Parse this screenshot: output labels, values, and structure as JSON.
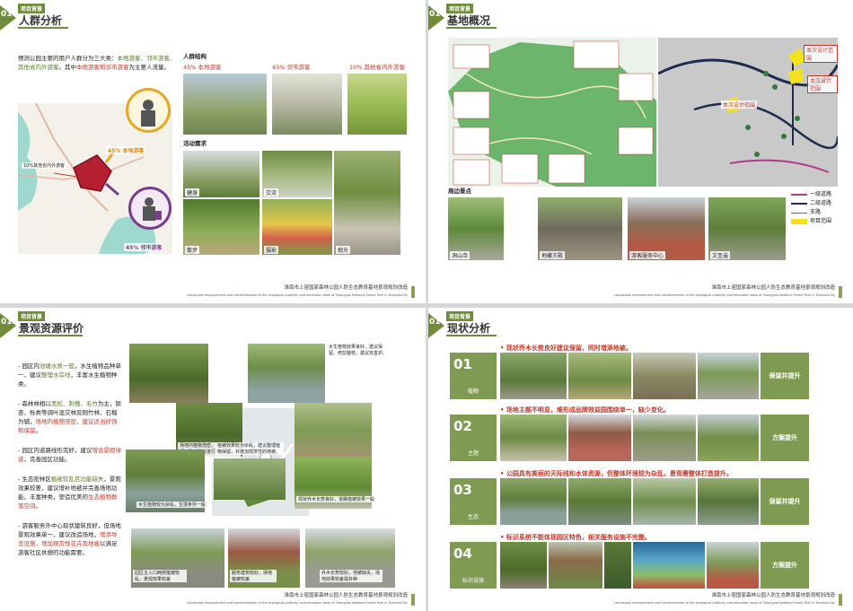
{
  "common": {
    "tag": "项目背景",
    "num": "01",
    "footer_cn": "淮南市上窑国家森林公园人防生态教育基地景观规划改造",
    "footer_en": "Landscape improvement and transformation of the ecological publicity and education base of Shangyao National Forest Park in HuainanCity"
  },
  "s1": {
    "title": "人群分析",
    "intro_a": "预测公园主要的用户人群分为三大类：",
    "intro_b": "本地游客、邻市游客、其他省内外游客",
    "intro_c": "。其中",
    "intro_d": "本地游客和邻市游客",
    "intro_e": "为主要人流量。",
    "structure_title": "人群结构",
    "struct": [
      "45% 本地游客",
      "45% 邻市游客",
      "10% 其他省内外游客"
    ],
    "activity_title": "活动需求",
    "activities": [
      "健身",
      "交流",
      "散步",
      "摄影",
      "观光"
    ],
    "map_labels": [
      "45% 本地游客",
      "10%其他省内外游客",
      "45% 邻市游客"
    ]
  },
  "s2": {
    "title": "基地概况",
    "design_labels": [
      "本次设计范围",
      "本次设计范围",
      "本次设计范围"
    ],
    "surroundings_title": "周边景点",
    "spots": [
      "洞山寺",
      "地藏王殿",
      "游客服务中心",
      "文圣庙"
    ],
    "legend": [
      "一级道路",
      "二级道路",
      "支路",
      "项目范围"
    ]
  },
  "s3": {
    "title": "景观资源评价",
    "points": [
      {
        "a": "- 园区内",
        "b": "池塘水质一般",
        "c": "，水生植物品种单一，建议",
        "d": "整理水岸线",
        "e": "，丰富水生植物种类。"
      },
      {
        "a": "- 森林林相以",
        "b": "黑松、刺槐、毛竹",
        "c": "为主，银杏、栎类等阔叶混交林及刚竹林、石榴为辅，",
        "d": "场地内植物茂密，建议适当修饰和保留",
        "e": "。"
      },
      {
        "a": "- 园区内道路线形完好，建议",
        "b": "增设景观绿道",
        "c": "，完善园区功能。",
        "d": "",
        "e": ""
      },
      {
        "a": "- 生态密林区",
        "b": "植被较乱且功能缺失",
        "c": "，景观效果较差，建议增补地被并完善场地功能，丰富种类，塑造优美的",
        "d": "生态植物群落空间",
        "e": "。"
      },
      {
        "a": "- 游客服务外中心现状建筑良好，但场地景观效果单一，建议改造场地，",
        "b": "增添导览设施，增加观赏性花卉及地被",
        "c": "以满足游客社区休憩的功能需要。",
        "d": "",
        "e": ""
      }
    ],
    "captions": [
      "水生植物效果良好，建议保留。修剪整枝，建议完善护。",
      "场地内植物茂密，场地需要整理，整体建议进行保留修剪，增加地被。",
      "植被效果较为杂乱，建议整理植物保留，并增加观赏性的地被。",
      "现状乔木长势良好，道路植被效果一般",
      "水生植物较为杂乱，生境条件一般",
      "园区主入口两侧植被较乱，景观效果较差",
      "服务建筑较好，场地植被较差",
      "乔木长势较好，地被缺失，场地效果较差需补种"
    ]
  },
  "s4": {
    "title": "现状分析",
    "rows": [
      {
        "num": "01",
        "label": "植物",
        "head": "• 现状乔木长势良好建议保留，同时增添地被。",
        "action": "保留并提升"
      },
      {
        "num": "02",
        "label": "主题",
        "head": "• 场地主题不明显，难形成品牌效益园围绕单一，缺少变化。",
        "action": "方案提升"
      },
      {
        "num": "03",
        "label": "生态",
        "head": "• 公园具有美丽的天际线和水体资源，但整体环境较为杂乱，景观需整体打造提升。",
        "action": "保留并提升"
      },
      {
        "num": "04",
        "label": "标识设施",
        "head": "• 标识系统不能体现园区特色，相关服务设施不完整。",
        "action": "方案提升"
      }
    ]
  }
}
